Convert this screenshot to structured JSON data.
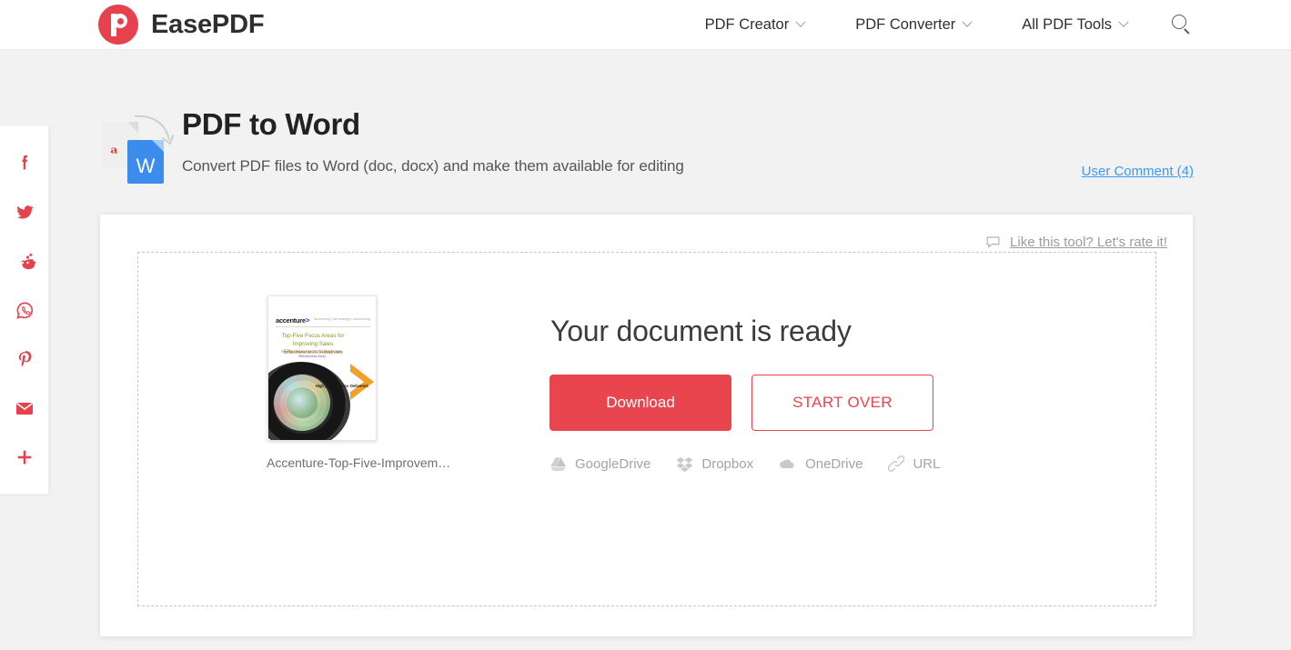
{
  "header": {
    "brand_name": "EasePDF",
    "logo_icon": "easepdf-logo-icon",
    "nav": [
      {
        "label": "PDF Creator",
        "icon": "chevron-down-icon"
      },
      {
        "label": "PDF Converter",
        "icon": "chevron-down-icon"
      },
      {
        "label": "All PDF Tools",
        "icon": "chevron-down-icon"
      }
    ],
    "search_icon": "search-icon"
  },
  "social_rail": {
    "items": [
      {
        "name": "facebook-icon",
        "label": "Facebook"
      },
      {
        "name": "twitter-icon",
        "label": "Twitter"
      },
      {
        "name": "reddit-icon",
        "label": "Reddit"
      },
      {
        "name": "whatsapp-icon",
        "label": "WhatsApp"
      },
      {
        "name": "pinterest-icon",
        "label": "Pinterest"
      },
      {
        "name": "email-icon",
        "label": "Email"
      },
      {
        "name": "more-share-icon",
        "label": "More"
      }
    ],
    "color": "#e8414e"
  },
  "tool": {
    "title": "PDF to Word",
    "subtitle": "Convert PDF files to Word (doc, docx) and make them available for editing",
    "pdf_icon": "pdf-file-icon",
    "word_icon": "word-file-icon",
    "arrow_icon": "curved-arrow-icon",
    "user_comment_label": "User Comment (4)"
  },
  "card": {
    "rate": {
      "icon": "comment-bubble-icon",
      "label": "Like this tool? Let's rate it!"
    },
    "thumbnail": {
      "doc_logo": "accenture",
      "doc_meta": "accounting  |  dot strategy  |  outsourcing",
      "doc_title": "Top-Five Focus Areas for Improving Sales Effectiveness Initiatives",
      "doc_subtitle": "Findings based on the 2013 Accenture Sales Effectiveness Study",
      "doc_tagline": "High performance. Delivered.",
      "file_name": "Accenture-Top-Five-Improvem…"
    },
    "ready_title": "Your document is ready",
    "download_label": "Download",
    "start_over_label": "START OVER",
    "download_color": "#e8454f",
    "cloud_targets": [
      {
        "label": "GoogleDrive",
        "icon": "google-drive-icon"
      },
      {
        "label": "Dropbox",
        "icon": "dropbox-icon"
      },
      {
        "label": "OneDrive",
        "icon": "onedrive-icon"
      },
      {
        "label": "URL",
        "icon": "link-icon"
      }
    ]
  }
}
